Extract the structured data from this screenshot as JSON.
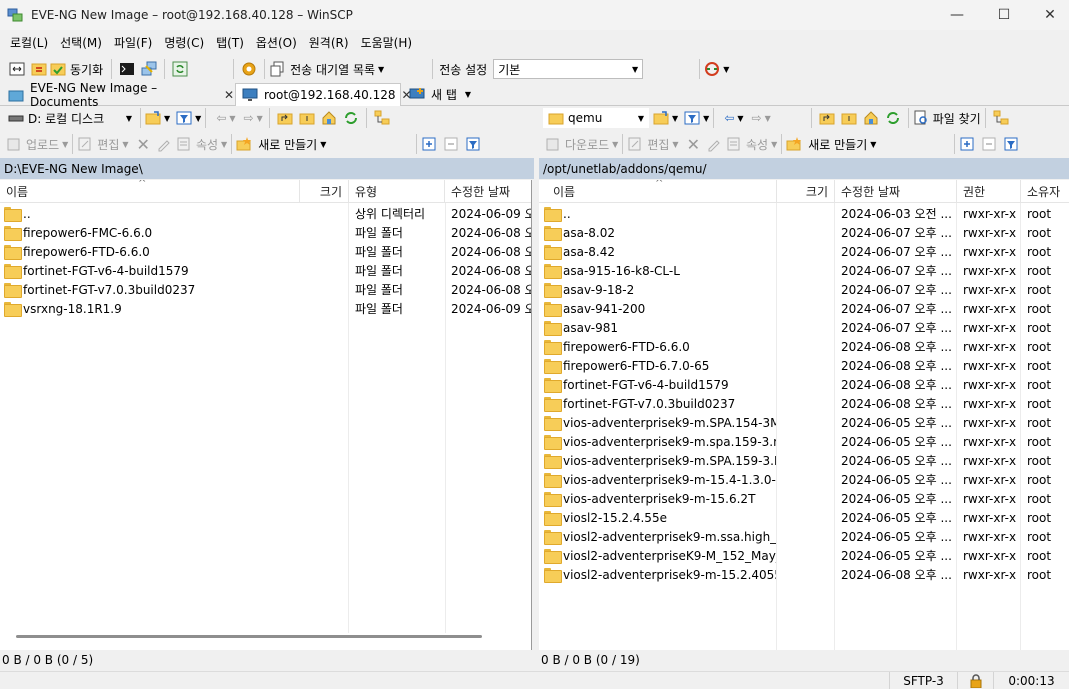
{
  "window": {
    "title": "EVE-NG New Image – root@192.168.40.128 – WinSCP",
    "minimize": "—",
    "maximize": "☐",
    "close": "✕"
  },
  "menu": [
    "로컬(L)",
    "선택(M)",
    "파일(F)",
    "명령(C)",
    "탭(T)",
    "옵션(O)",
    "원격(R)",
    "도움말(H)"
  ],
  "toolbar": {
    "sync_label": "동기화",
    "queue_label": "전송 대기열 목록",
    "transfer_settings_label": "전송 설정",
    "transfer_settings_value": "기본"
  },
  "tabs": [
    {
      "label": "EVE-NG New Image – Documents"
    },
    {
      "label": "root@192.168.40.128"
    },
    {
      "label": "새 탭"
    }
  ],
  "local": {
    "drive": "D: 로컬 디스크",
    "upload_label": "업로드",
    "edit_label": "편집",
    "properties_label": "속성",
    "new_label": "새로 만들기",
    "path": "D:\\EVE-NG New Image\\",
    "columns": [
      "이름",
      "크기",
      "유형",
      "수정한 날짜"
    ],
    "rows": [
      {
        "name": "..",
        "size": "",
        "type": "상위 디렉터리",
        "modified": "2024-06-09 오"
      },
      {
        "name": "firepower6-FMC-6.6.0",
        "size": "",
        "type": "파일 폴더",
        "modified": "2024-06-08 오"
      },
      {
        "name": "firepower6-FTD-6.6.0",
        "size": "",
        "type": "파일 폴더",
        "modified": "2024-06-08 오"
      },
      {
        "name": "fortinet-FGT-v6-4-build1579",
        "size": "",
        "type": "파일 폴더",
        "modified": "2024-06-08 오"
      },
      {
        "name": "fortinet-FGT-v7.0.3build0237",
        "size": "",
        "type": "파일 폴더",
        "modified": "2024-06-08 오"
      },
      {
        "name": "vsrxng-18.1R1.9",
        "size": "",
        "type": "파일 폴더",
        "modified": "2024-06-09 오"
      }
    ],
    "status": "0 B / 0 B (0 / 5)"
  },
  "remote": {
    "dir": "qemu",
    "download_label": "다운로드",
    "edit_label": "편집",
    "properties_label": "속성",
    "new_label": "새로 만들기",
    "find_label": "파일 찾기",
    "path": "/opt/unetlab/addons/qemu/",
    "columns": [
      "이름",
      "크기",
      "수정한 날짜",
      "권한",
      "소유자"
    ],
    "rows": [
      {
        "name": "..",
        "modified": "2024-06-03 오전 ...",
        "rights": "rwxr-xr-x",
        "owner": "root"
      },
      {
        "name": "asa-8.02",
        "modified": "2024-06-07 오후 ...",
        "rights": "rwxr-xr-x",
        "owner": "root"
      },
      {
        "name": "asa-8.42",
        "modified": "2024-06-07 오후 ...",
        "rights": "rwxr-xr-x",
        "owner": "root"
      },
      {
        "name": "asa-915-16-k8-CL-L",
        "modified": "2024-06-07 오후 ...",
        "rights": "rwxr-xr-x",
        "owner": "root"
      },
      {
        "name": "asav-9-18-2",
        "modified": "2024-06-07 오후 ...",
        "rights": "rwxr-xr-x",
        "owner": "root"
      },
      {
        "name": "asav-941-200",
        "modified": "2024-06-07 오후 ...",
        "rights": "rwxr-xr-x",
        "owner": "root"
      },
      {
        "name": "asav-981",
        "modified": "2024-06-07 오후 ...",
        "rights": "rwxr-xr-x",
        "owner": "root"
      },
      {
        "name": "firepower6-FTD-6.6.0",
        "modified": "2024-06-08 오후 ...",
        "rights": "rwxr-xr-x",
        "owner": "root"
      },
      {
        "name": "firepower6-FTD-6.7.0-65",
        "modified": "2024-06-08 오후 ...",
        "rights": "rwxr-xr-x",
        "owner": "root"
      },
      {
        "name": "fortinet-FGT-v6-4-build1579",
        "modified": "2024-06-08 오후 ...",
        "rights": "rwxr-xr-x",
        "owner": "root"
      },
      {
        "name": "fortinet-FGT-v7.0.3build0237",
        "modified": "2024-06-08 오후 ...",
        "rights": "rwxr-xr-x",
        "owner": "root"
      },
      {
        "name": "vios-adventerprisek9-m.SPA.154-3M8",
        "modified": "2024-06-05 오후 ...",
        "rights": "rwxr-xr-x",
        "owner": "root"
      },
      {
        "name": "vios-adventerprisek9-m.spa.159-3.m2",
        "modified": "2024-06-05 오후 ...",
        "rights": "rwxr-xr-x",
        "owner": "root"
      },
      {
        "name": "vios-adventerprisek9-m.SPA.159-3.M3",
        "modified": "2024-06-05 오후 ...",
        "rights": "rwxr-xr-x",
        "owner": "root"
      },
      {
        "name": "vios-adventerprisek9-m-15.4-1.3.0-1...",
        "modified": "2024-06-05 오후 ...",
        "rights": "rwxr-xr-x",
        "owner": "root"
      },
      {
        "name": "vios-adventerprisek9-m-15.6.2T",
        "modified": "2024-06-05 오후 ...",
        "rights": "rwxr-xr-x",
        "owner": "root"
      },
      {
        "name": "viosl2-15.2.4.55e",
        "modified": "2024-06-05 오후 ...",
        "rights": "rwxr-xr-x",
        "owner": "root"
      },
      {
        "name": "viosl2-adventerprisek9-m.ssa.high_iro...",
        "modified": "2024-06-05 오후 ...",
        "rights": "rwxr-xr-x",
        "owner": "root"
      },
      {
        "name": "viosl2-adventerpriseK9-M_152_May_...",
        "modified": "2024-06-05 오후 ...",
        "rights": "rwxr-xr-x",
        "owner": "root"
      },
      {
        "name": "viosl2-adventerprisek9-m-15.2.4055",
        "modified": "2024-06-08 오후 ...",
        "rights": "rwxr-xr-x",
        "owner": "root"
      }
    ],
    "status": "0 B / 0 B (0 / 19)"
  },
  "statusbar": {
    "protocol": "SFTP-3",
    "elapsed": "0:00:13"
  }
}
